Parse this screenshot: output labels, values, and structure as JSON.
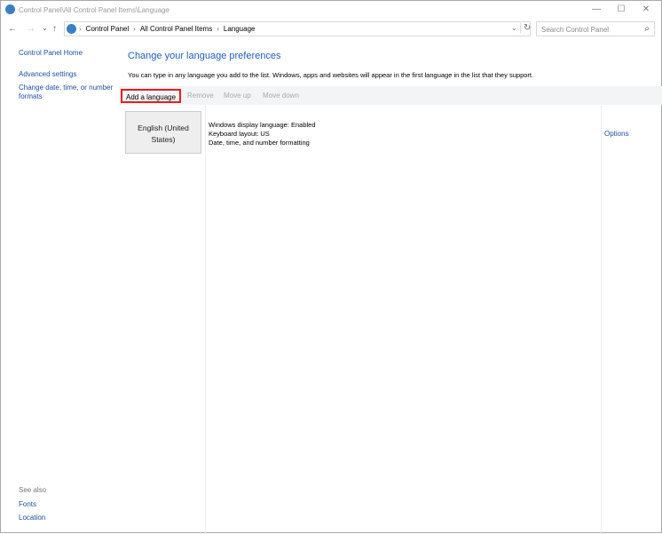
{
  "window": {
    "title": "Control Panel\\All Control Panel Items\\Language"
  },
  "nav": {
    "back": "←",
    "forward": "→",
    "recent": "⌄",
    "up": "↑",
    "breadcrumb": [
      "Control Panel",
      "All Control Panel Items",
      "Language"
    ],
    "separator": "›",
    "dropdown": "⌄",
    "refresh": "↻",
    "search_placeholder": "Search Control Panel",
    "search_icon": "⌕"
  },
  "sidebar": {
    "items": [
      "Control Panel Home",
      "Advanced settings",
      "Change date, time, or number formats"
    ],
    "see_also": "See also",
    "see_also_items": [
      "Fonts",
      "Location"
    ]
  },
  "main": {
    "heading": "Change your language preferences",
    "description": "You can type in any language you add to the list. Windows, apps and websites will appear in the first language in the list that they support.",
    "toolbar": [
      "Add a language",
      "Remove",
      "Move up",
      "Move down"
    ],
    "languages": [
      {
        "name": "English (United States)",
        "details": [
          "Windows display language: Enabled",
          "Keyboard layout: US",
          "Date, time, and number formatting"
        ],
        "options": "Options"
      }
    ]
  }
}
